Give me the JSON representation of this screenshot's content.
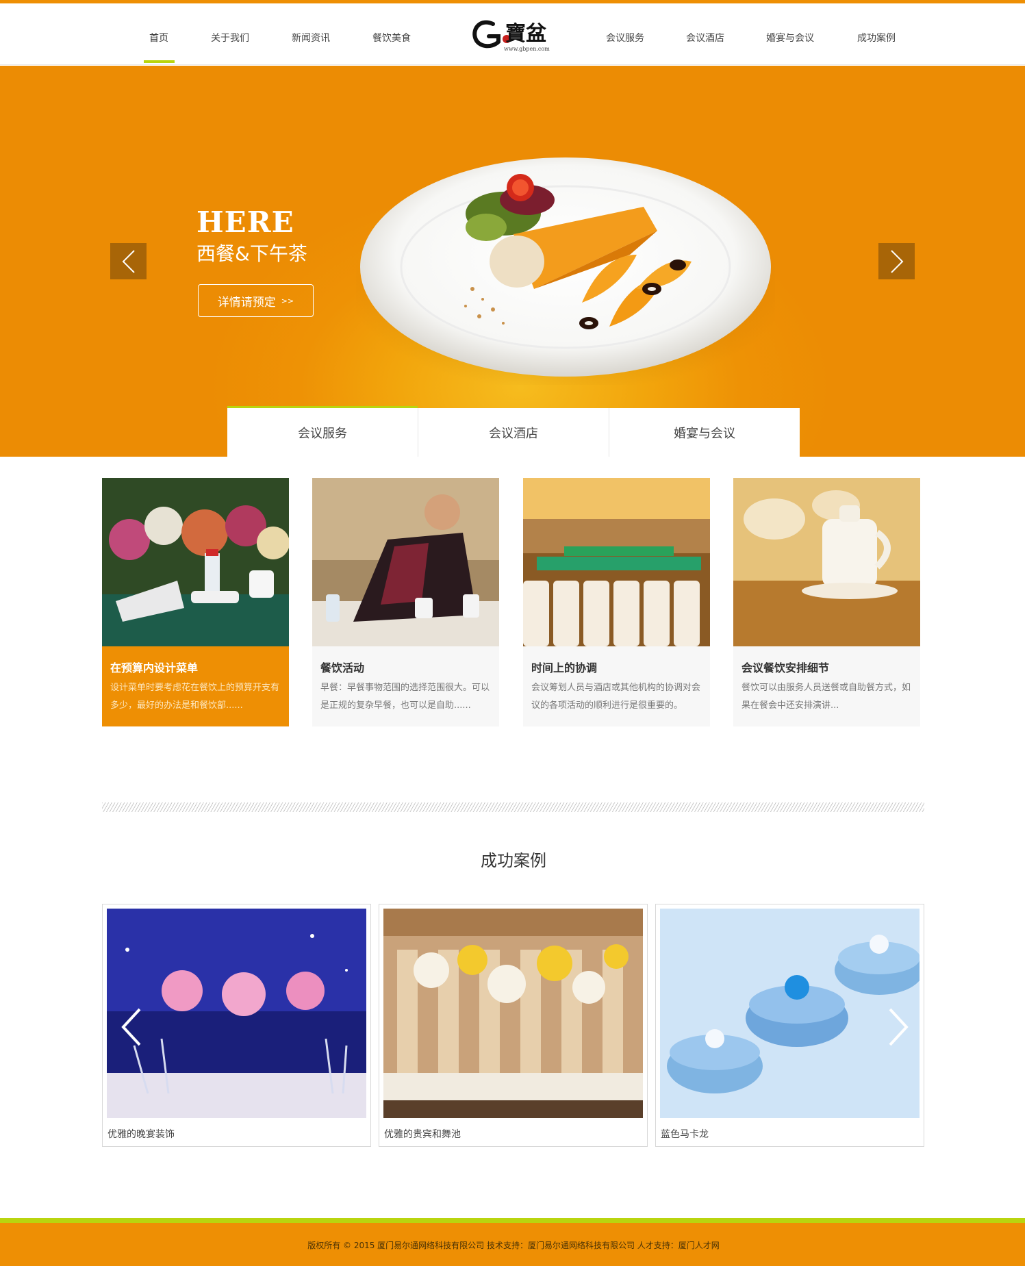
{
  "nav": {
    "left": [
      "首页",
      "关于我们",
      "新闻资讯",
      "餐饮美食"
    ],
    "right": [
      "会议服务",
      "会议酒店",
      "婚宴与会议",
      "成功案例"
    ],
    "active": "首页"
  },
  "logo": {
    "url_text": "www.gbpen.com"
  },
  "hero": {
    "title_en": "HERE",
    "title_cn": "西餐&下午茶",
    "button_label": "详情请预定",
    "button_arrow": ">>"
  },
  "tabs": [
    "会议服务",
    "会议酒店",
    "婚宴与会议"
  ],
  "services": [
    {
      "title": "在预算内设计菜单",
      "desc": "设计菜单时要考虑花在餐饮上的预算开支有多少，最好的办法是和餐饮部......"
    },
    {
      "title": "餐饮活动",
      "desc": "早餐：早餐事物范围的选择范围很大。可以是正规的复杂早餐，也可以是自助......"
    },
    {
      "title": "时间上的协调",
      "desc": "会议筹划人员与酒店或其他机构的协调对会议的各项活动的顺利进行是很重要的。"
    },
    {
      "title": "会议餐饮安排细节",
      "desc": "餐饮可以由服务人员送餐或自助餐方式，如果在餐会中还安排演讲..."
    }
  ],
  "cases_section": {
    "title": "成功案例",
    "items": [
      "优雅的晚宴装饰",
      "优雅的贵宾和舞池",
      "蓝色马卡龙"
    ]
  },
  "footer": {
    "text": "版权所有 © 2015 厦门易尔通网络科技有限公司  技术支持：厦门易尔通网络科技有限公司 人才支持：厦门人才网"
  },
  "colors": {
    "accent_orange": "#ee8f04",
    "accent_green": "#b9d50f"
  }
}
